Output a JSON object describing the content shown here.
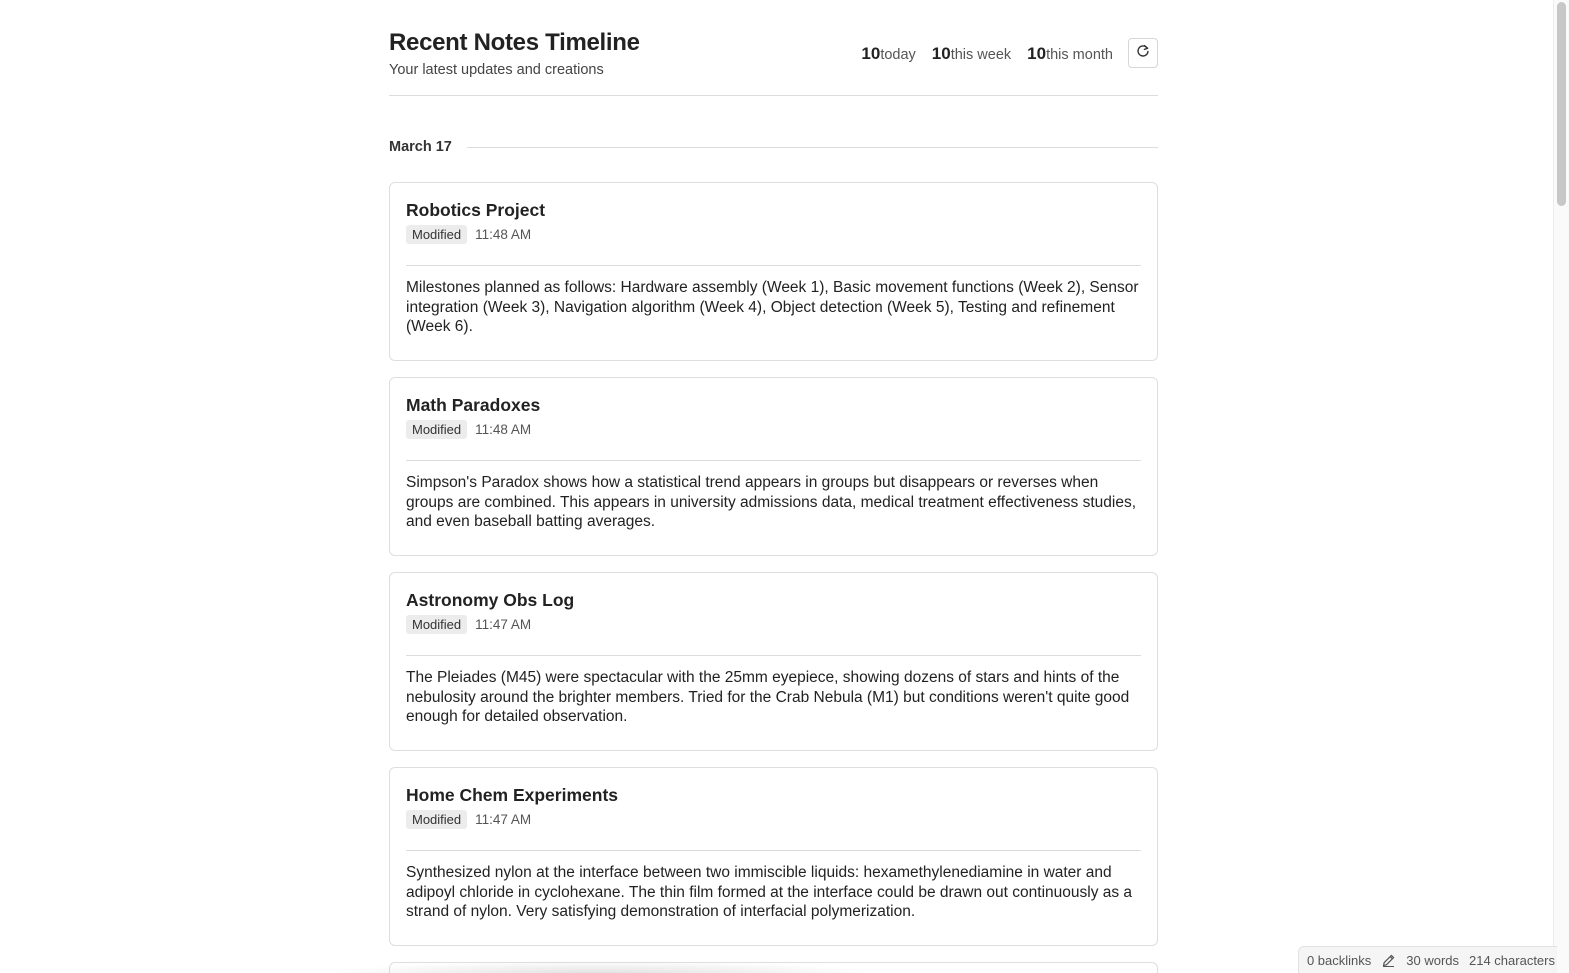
{
  "header": {
    "title": "Recent Notes Timeline",
    "subtitle": "Your latest updates and creations",
    "stats": [
      {
        "value": "10",
        "label": "today"
      },
      {
        "value": "10",
        "label": "this week"
      },
      {
        "value": "10",
        "label": "this month"
      }
    ],
    "refresh_icon": "refresh-icon"
  },
  "group": {
    "date": "March 17",
    "notes": [
      {
        "title": "Robotics Project",
        "status": "Modified",
        "time": "11:48 AM",
        "body": "Milestones planned as follows: Hardware assembly (Week 1), Basic movement functions (Week 2), Sensor integration (Week 3), Navigation algorithm (Week 4), Object detection (Week 5), Testing and refinement (Week 6)."
      },
      {
        "title": "Math Paradoxes",
        "status": "Modified",
        "time": "11:48 AM",
        "body": "Simpson's Paradox shows how a statistical trend appears in groups but disappears or reverses when groups are combined. This appears in university admissions data, medical treatment effectiveness studies, and even baseball batting averages."
      },
      {
        "title": "Astronomy Obs Log",
        "status": "Modified",
        "time": "11:47 AM",
        "body": "The Pleiades (M45) were spectacular with the 25mm eyepiece, showing dozens of stars and hints of the nebulosity around the brighter members. Tried for the Crab Nebula (M1) but conditions weren't quite good enough for detailed observation."
      },
      {
        "title": "Home Chem Experiments",
        "status": "Modified",
        "time": "11:47 AM",
        "body": "Synthesized nylon at the interface between two immiscible liquids: hexamethylenediamine in water and adipoyl chloride in cyclohexane. The thin film formed at the interface could be drawn out continuously as a strand of nylon. Very satisfying demonstration of interfacial polymerization."
      }
    ]
  },
  "statusbar": {
    "backlinks": "0 backlinks",
    "edit_icon": "pencil-icon",
    "words": "30 words",
    "characters": "214 characters"
  }
}
